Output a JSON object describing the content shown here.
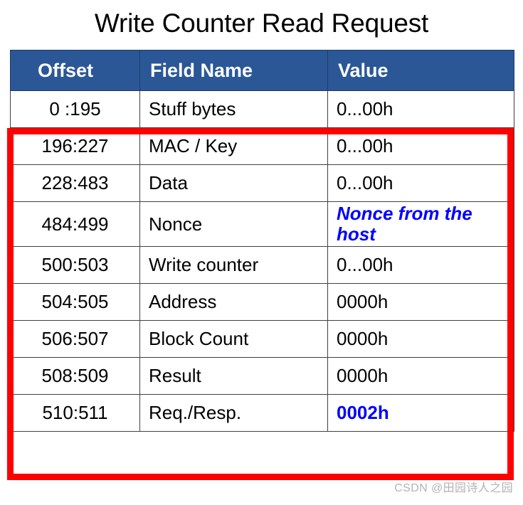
{
  "page": {
    "title": "Write Counter Read Request",
    "watermark": "CSDN @田园诗人之园"
  },
  "colors": {
    "header_background": "#2B5797",
    "header_text": "#FFFFFF",
    "highlight_border": "#FF0000",
    "accent_value_text": "#0000FF",
    "grid_line": "#404040",
    "watermark_text": "#B3B3B3",
    "body_text": "#000000",
    "page_background": "#FFFFFF"
  },
  "table": {
    "columns": [
      {
        "key": "offset",
        "label": "Offset"
      },
      {
        "key": "field_name",
        "label": "Field Name"
      },
      {
        "key": "value",
        "label": "Value"
      }
    ],
    "rows": [
      {
        "offset": "0 :195",
        "field_name": "Stuff bytes",
        "value": "0...00h",
        "value_style": "plain",
        "highlighted": false
      },
      {
        "offset": "196:227",
        "field_name": "MAC / Key",
        "value": "0...00h",
        "value_style": "plain",
        "highlighted": true
      },
      {
        "offset": "228:483",
        "field_name": "Data",
        "value": "0...00h",
        "value_style": "plain",
        "highlighted": true
      },
      {
        "offset": "484:499",
        "field_name": "Nonce",
        "value": "Nonce from the host",
        "value_style": "blue-italic",
        "highlighted": true
      },
      {
        "offset": "500:503",
        "field_name": "Write counter",
        "value": "0...00h",
        "value_style": "plain",
        "highlighted": true
      },
      {
        "offset": "504:505",
        "field_name": "Address",
        "value": "0000h",
        "value_style": "plain",
        "highlighted": true
      },
      {
        "offset": "506:507",
        "field_name": "Block Count",
        "value": "0000h",
        "value_style": "plain",
        "highlighted": true
      },
      {
        "offset": "508:509",
        "field_name": "Result",
        "value": "0000h",
        "value_style": "plain",
        "highlighted": true
      },
      {
        "offset": "510:511",
        "field_name": "Req./Resp.",
        "value": "0002h",
        "value_style": "blue",
        "highlighted": true
      }
    ]
  },
  "annotation": {
    "highlight_label": "red-highlight-rectangle",
    "highlight_covers_rows": "196:227 through 510:511"
  }
}
